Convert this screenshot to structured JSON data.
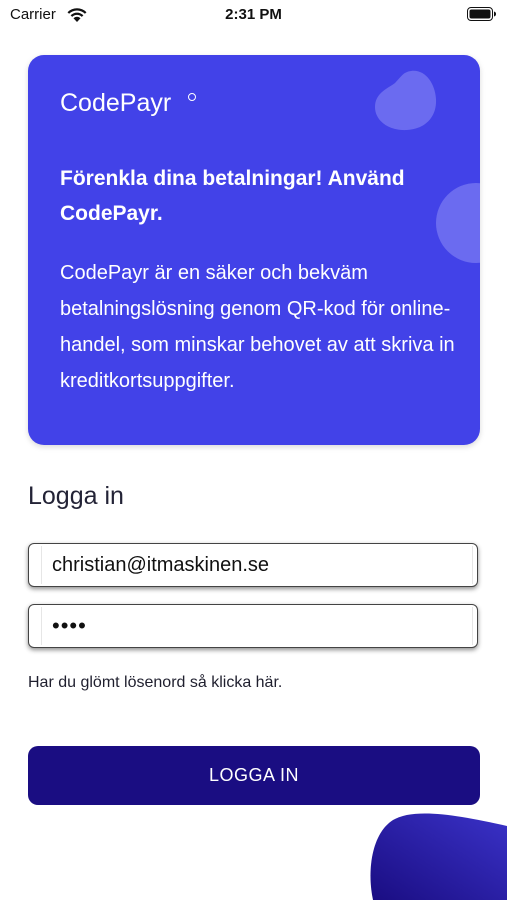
{
  "status_bar": {
    "carrier": "Carrier",
    "time": "2:31 PM",
    "icons": [
      "wifi-icon",
      "battery-icon"
    ]
  },
  "hero": {
    "brand": "CodePayr",
    "headline": "Förenkla dina betalningar! Använd CodePayr.",
    "description": "CodePayr är en säker och bekväm betalningslösning genom QR-kod för online-handel, som minskar behovet av att skriva in kreditkortsuppgifter."
  },
  "login": {
    "title": "Logga in",
    "email_value": "christian@itmaskinen.se",
    "password_value": "••••",
    "forgot_text": "Har du glömt lösenord så klicka här.",
    "button_label": "LOGGA IN"
  },
  "colors": {
    "hero_background": "#4242e8",
    "hero_blob": "#6b6bf0",
    "button_background": "#1a0d82",
    "button_text": "#ffffff",
    "corner_blob": "#2d22b8"
  }
}
